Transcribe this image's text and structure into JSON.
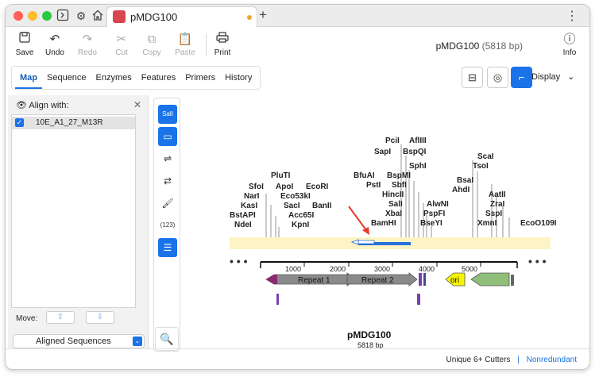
{
  "tab": {
    "title": "pMDG100"
  },
  "toolbar": {
    "save": "Save",
    "undo": "Undo",
    "redo": "Redo",
    "cut": "Cut",
    "copy": "Copy",
    "paste": "Paste",
    "print": "Print",
    "info": "Info"
  },
  "header": {
    "name": "pMDG100",
    "length": "(5818 bp)"
  },
  "views": [
    "Map",
    "Sequence",
    "Enzymes",
    "Features",
    "Primers",
    "History"
  ],
  "display_label": "Display",
  "align_panel": {
    "title": "Align with:",
    "items": [
      "10E_A1_27_M13R"
    ],
    "move_label": "Move:",
    "aligned_label": "Aligned Sequences"
  },
  "vertical_tools": {
    "enzyme_label": "SalI",
    "numbers_label": "(123)"
  },
  "map": {
    "name": "pMDG100",
    "length_label": "5818 bp",
    "ticks": [
      "1000",
      "2000",
      "3000",
      "4000",
      "5000"
    ],
    "features": [
      {
        "label": "Repeat 1",
        "color": "#8a8a8a"
      },
      {
        "label": "Repeat 2",
        "color": "#8a8a8a"
      },
      {
        "label": "ori",
        "color": "#f5f500"
      }
    ],
    "enzymes_left": [
      "PluTI",
      "SfoI",
      "ApoI",
      "EcoRI",
      "NarI",
      "Eco53kI",
      "KasI",
      "SacI",
      "BanII",
      "BstAPI",
      "Acc65I",
      "NdeI",
      "KpnI"
    ],
    "enzymes_mid": [
      "PciI",
      "AflIII",
      "SapI",
      "BspQI",
      "SphI",
      "BfuAI",
      "BspMI",
      "PstI",
      "SbfI",
      "HincII",
      "AlwNI",
      "SalI",
      "PspFI",
      "XbaI",
      "BamHI",
      "BseYI"
    ],
    "enzymes_right": [
      "ScaI",
      "TsoI",
      "BsaI",
      "AhdI",
      "AatII",
      "ZraI",
      "SspI",
      "XmnI",
      "EcoO109I"
    ]
  },
  "status": {
    "cutters": "Unique 6+ Cutters",
    "mode": "Nonredundant"
  }
}
